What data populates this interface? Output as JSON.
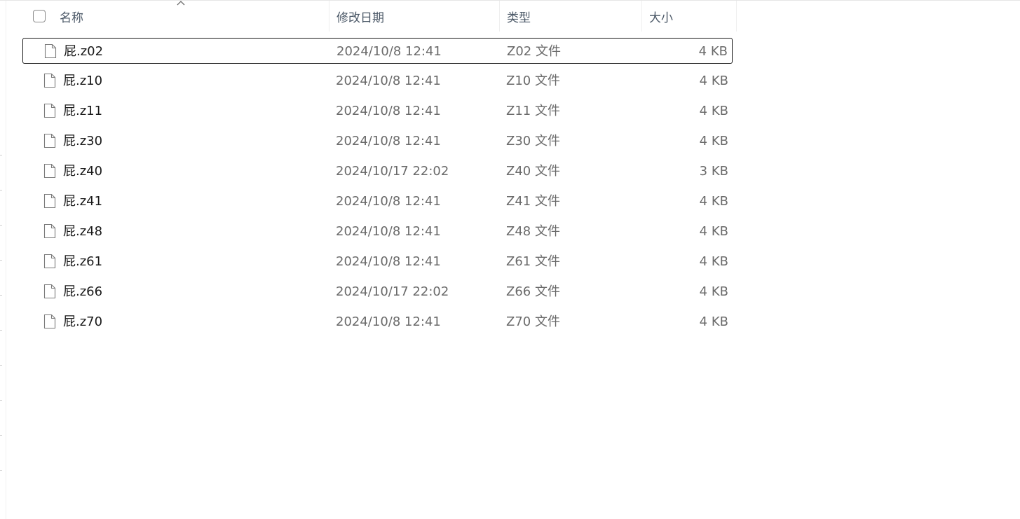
{
  "columns": {
    "name": "名称",
    "date": "修改日期",
    "type": "类型",
    "size": "大小"
  },
  "icons": {
    "sort": "chevron-up-icon",
    "file": "file-icon",
    "checkbox": "checkbox-icon"
  },
  "files": [
    {
      "name": "屁.z02",
      "date": "2024/10/8 12:41",
      "type": "Z02 文件",
      "size": "4 KB"
    },
    {
      "name": "屁.z10",
      "date": "2024/10/8 12:41",
      "type": "Z10 文件",
      "size": "4 KB"
    },
    {
      "name": "屁.z11",
      "date": "2024/10/8 12:41",
      "type": "Z11 文件",
      "size": "4 KB"
    },
    {
      "name": "屁.z30",
      "date": "2024/10/8 12:41",
      "type": "Z30 文件",
      "size": "4 KB"
    },
    {
      "name": "屁.z40",
      "date": "2024/10/17 22:02",
      "type": "Z40 文件",
      "size": "3 KB"
    },
    {
      "name": "屁.z41",
      "date": "2024/10/8 12:41",
      "type": "Z41 文件",
      "size": "4 KB"
    },
    {
      "name": "屁.z48",
      "date": "2024/10/8 12:41",
      "type": "Z48 文件",
      "size": "4 KB"
    },
    {
      "name": "屁.z61",
      "date": "2024/10/8 12:41",
      "type": "Z61 文件",
      "size": "4 KB"
    },
    {
      "name": "屁.z66",
      "date": "2024/10/17 22:02",
      "type": "Z66 文件",
      "size": "4 KB"
    },
    {
      "name": "屁.z70",
      "date": "2024/10/8 12:41",
      "type": "Z70 文件",
      "size": "4 KB"
    }
  ]
}
